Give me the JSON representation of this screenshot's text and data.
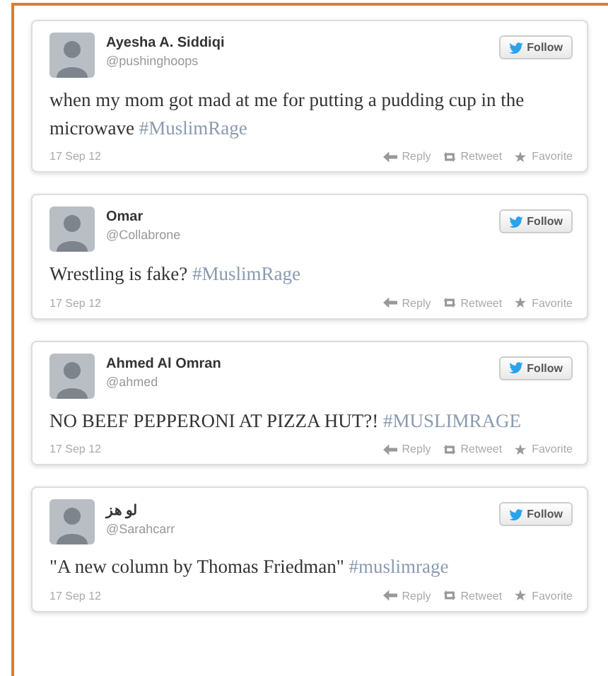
{
  "tweets": [
    {
      "name": "Ayesha A. Siddiqi",
      "handle": "@pushinghoops",
      "text": "when my mom got mad at me for putting a pudding cup in the microwave",
      "hashtag": "#MuslimRage",
      "date": "17 Sep 12",
      "follow": "Follow",
      "actions": [
        "Reply",
        "Retweet",
        "Favorite"
      ]
    },
    {
      "name": "Omar",
      "handle": "@Collabrone",
      "text": "Wrestling is fake?",
      "hashtag": "#MuslimRage",
      "date": "17 Sep 12",
      "follow": "Follow",
      "actions": [
        "Reply",
        "Retweet",
        "Favorite"
      ]
    },
    {
      "name": "Ahmed Al Omran",
      "handle": "@ahmed",
      "text": "NO BEEF PEPPERONI AT PIZZA HUT?!",
      "hashtag": "#MUSLIMRAGE",
      "date": "17 Sep 12",
      "follow": "Follow",
      "actions": [
        "Reply",
        "Retweet",
        "Favorite"
      ]
    },
    {
      "name": "لو هز",
      "handle": "@Sarahcarr",
      "text": "\"A new column by Thomas Friedman\"",
      "hashtag": "#muslimrage",
      "date": "17 Sep 12",
      "follow": "Follow",
      "actions": [
        "Reply",
        "Retweet",
        "Favorite"
      ]
    }
  ]
}
